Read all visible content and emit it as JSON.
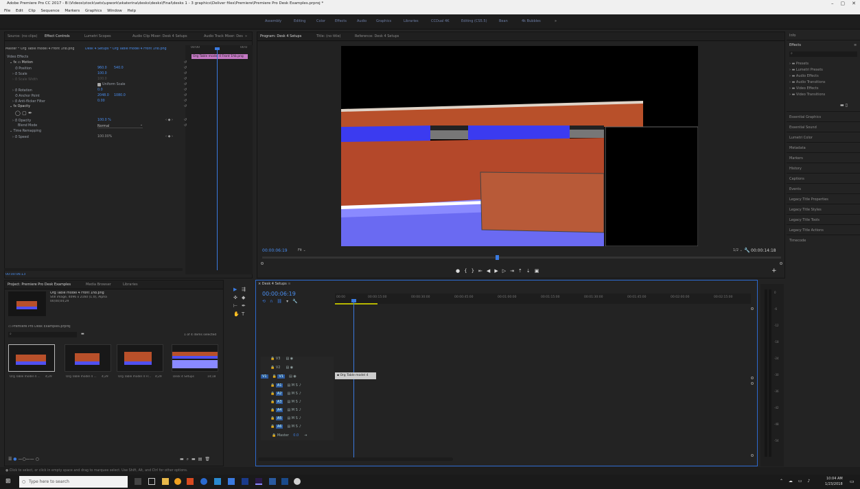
{
  "app": {
    "title": "Adobe Premiere Pro CC 2017 - B:\\Videos\\stock\\sets\\upwork\\ekaterina\\desks\\desks\\Final\\desks 1 - 3 graphics\\Deliver files\\Premiere\\Premiere Pro Desk Examples.prproj *",
    "menu": [
      "File",
      "Edit",
      "Clip",
      "Sequence",
      "Markers",
      "Graphics",
      "Window",
      "Help"
    ]
  },
  "workspaces": [
    "Assembly",
    "Editing",
    "Color",
    "Effects",
    "Audio",
    "Graphics",
    "Libraries",
    "CCDual 4K",
    "Editing (CS5.5)",
    "Bean",
    "4k Bubbles",
    "»"
  ],
  "effect_controls": {
    "tabs": [
      "Source: (no clips)",
      "Effect Controls",
      "Lumetri Scopes",
      "Audio Clip Mixer: Desk 4 Setups",
      "Audio Track Mixer: Des",
      "»"
    ],
    "master": "Master * Org Table model 4 Front 1hb.png",
    "clip": "Desk 4 Setups * Org Table model 4 Front 1hb.png",
    "timecode_start": "00:00",
    "timecode_end": "00:0",
    "clip_label": "Org Table model 4 Front 1hb.png",
    "section_video": "Video Effects",
    "motion": "Motion",
    "position_label": "Position",
    "position_x": "960.0",
    "position_y": "540.0",
    "scale_label": "Scale",
    "scale_val": "100.0",
    "scale_width_label": "Scale Width",
    "scale_width_val": "100.0",
    "uniform_scale": "Uniform Scale",
    "rotation_label": "Rotation",
    "rotation_val": "0.0",
    "anchor_label": "Anchor Point",
    "anchor_x": "2048.0",
    "anchor_y": "1080.0",
    "antiflicker_label": "Anti-flicker Filter",
    "antiflicker_val": "0.00",
    "opacity": "Opacity",
    "opacity_label": "Opacity",
    "opacity_val": "100.0 %",
    "blend_label": "Blend Mode",
    "blend_val": "Normal",
    "time_remap": "Time Remapping",
    "speed_label": "Speed",
    "speed_val": "100.00%",
    "bottom_timecode": "00:00:06:13"
  },
  "program": {
    "tabs": [
      "Program: Desk 4 Setups",
      "Title: (no title)",
      "Reference: Desk 4 Setups"
    ],
    "timecode": "00:00:06:19",
    "fit": "Fit",
    "quality": "1/2",
    "duration": "00:00:14:18"
  },
  "project": {
    "tabs": [
      "Project: Premiere Pro Desk Examples",
      "Media Browser",
      "Libraries"
    ],
    "clip_name": "Org Table model 4 Front 1hb.png",
    "clip_info": "Still image, 4096 x 2160 (1.0), Alpha",
    "clip_duration": "00;00;04;29",
    "path": "Premiere Pro Desk Examples.prproj",
    "items_selected": "1 of 4 items selected",
    "thumbs": [
      {
        "label": "Org Table model 4 ...",
        "dur": "4;29"
      },
      {
        "label": "Org Table model 4 ...",
        "dur": "4;29"
      },
      {
        "label": "Org Table model 4 Fr...",
        "dur": "4;29"
      },
      {
        "label": "Desk 4 Setups",
        "dur": "14;18"
      }
    ]
  },
  "timeline": {
    "tab": "Desk 4 Setups",
    "timecode": "00:00:06:19",
    "ruler": [
      "00:00",
      "00:00:15:00",
      "00:00:30:00",
      "00:00:45:00",
      "00:01:00:00",
      "00:01:15:00",
      "00:01:30:00",
      "00:01:45:00",
      "00:02:00:00",
      "00:02:15:00"
    ],
    "video_tracks": [
      "V3",
      "V2",
      "V1"
    ],
    "audio_tracks": [
      "A1",
      "A2",
      "A3",
      "A4",
      "A5",
      "A6"
    ],
    "master_label": "Master",
    "master_val": "0.0",
    "clip_label": "Org Table model 4",
    "vu_labels": [
      "0",
      "-6",
      "-12",
      "-18",
      "-24",
      "-30",
      "-36",
      "-42",
      "-48",
      "-54"
    ]
  },
  "right_panel": {
    "info": "Info",
    "effects": "Effects",
    "tree": [
      "Presets",
      "Lumetri Presets",
      "Audio Effects",
      "Audio Transitions",
      "Video Effects",
      "Video Transitions"
    ],
    "items": [
      "Essential Graphics",
      "Essential Sound",
      "Lumetri Color",
      "Metadata",
      "Markers",
      "History",
      "Captions",
      "Events",
      "Legacy Title Properties",
      "Legacy Title Styles",
      "Legacy Title Tools",
      "Legacy Title Actions",
      "Timecode"
    ]
  },
  "status": "Click to select, or click in empty space and drag to marquee select. Use Shift, Alt, and Ctrl for other options.",
  "taskbar": {
    "search": "Type here to search",
    "time": "10:04 AM",
    "date": "1/23/2018"
  }
}
